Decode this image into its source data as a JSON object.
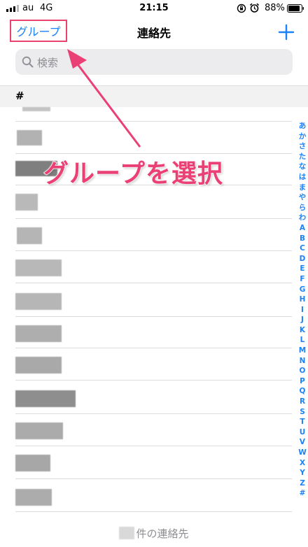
{
  "status_bar": {
    "carrier": "au",
    "network": "4G",
    "time": "21:15",
    "battery": "88%",
    "icons": [
      "signal-icon",
      "orientation-lock-icon",
      "alarm-icon",
      "battery-icon"
    ]
  },
  "nav": {
    "left_button": "グループ",
    "title": "連絡先",
    "add_icon": "plus-icon"
  },
  "search": {
    "placeholder": "検索",
    "icon": "search-icon"
  },
  "section": {
    "header": "#"
  },
  "contacts_count_suffix": "件の連絡先",
  "index_letters": [
    "あ",
    "か",
    "さ",
    "た",
    "な",
    "は",
    "ま",
    "や",
    "ら",
    "わ",
    "A",
    "B",
    "C",
    "D",
    "E",
    "F",
    "G",
    "H",
    "I",
    "J",
    "K",
    "L",
    "M",
    "N",
    "O",
    "P",
    "Q",
    "R",
    "S",
    "T",
    "U",
    "V",
    "W",
    "X",
    "Y",
    "Z",
    "#"
  ],
  "annotation": {
    "text": "グループを選択"
  },
  "colors": {
    "accent": "#1a82fb",
    "annotation": "#ea4075",
    "highlight_border": "#e8436f"
  }
}
